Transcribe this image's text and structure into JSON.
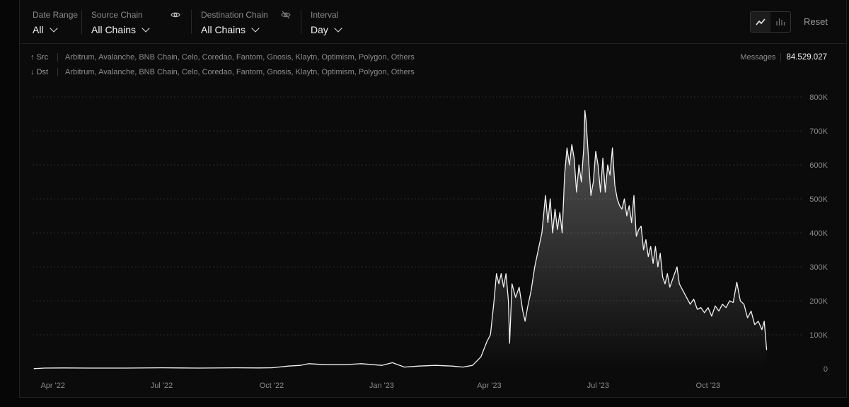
{
  "filters": {
    "date_range": {
      "label": "Date Range",
      "value": "All"
    },
    "source_chain": {
      "label": "Source Chain",
      "value": "All Chains"
    },
    "destination_chain": {
      "label": "Destination Chain",
      "value": "All Chains"
    },
    "interval": {
      "label": "Interval",
      "value": "Day"
    }
  },
  "view_toggle": {
    "selected": "line",
    "options": [
      "line-chart-icon",
      "bar-chart-icon"
    ]
  },
  "reset_label": "Reset",
  "legend": {
    "src": {
      "key": "Src",
      "chains": "Arbitrum, Avalanche, BNB Chain, Celo, Coredao, Fantom, Gnosis, Klaytn, Optimism, Polygon, Others"
    },
    "dst": {
      "key": "Dst",
      "chains": "Arbitrum, Avalanche, BNB Chain, Celo, Coredao, Fantom, Gnosis, Klaytn, Optimism, Polygon, Others"
    }
  },
  "messages": {
    "label": "Messages",
    "value": "84.529.027"
  },
  "colors": {
    "background": "#0b0b0b",
    "line": "#f2f2f2",
    "grid": "#2a2a2a",
    "text_muted": "#8a8a8a"
  },
  "chart_data": {
    "type": "area",
    "x_range": [
      "2022-03-15",
      "2023-12-20"
    ],
    "ylim": [
      0,
      800000
    ],
    "yticks": [
      0,
      100000,
      200000,
      300000,
      400000,
      500000,
      600000,
      700000,
      800000
    ],
    "ytick_labels": [
      "0",
      "100K",
      "200K",
      "300K",
      "400K",
      "500K",
      "600K",
      "700K",
      "800K"
    ],
    "xticks": [
      "2022-04-01",
      "2022-07-01",
      "2022-10-01",
      "2023-01-01",
      "2023-04-01",
      "2023-07-01",
      "2023-10-01"
    ],
    "xtick_labels": [
      "Apr '22",
      "Jul '22",
      "Oct '22",
      "Jan '23",
      "Apr '23",
      "Jul '23",
      "Oct '23"
    ],
    "grid": true,
    "series": [
      {
        "values": [
          [
            "2022-03-16",
            500
          ],
          [
            "2022-03-25",
            2000
          ],
          [
            "2022-04-10",
            2500
          ],
          [
            "2022-05-01",
            2000
          ],
          [
            "2022-06-01",
            2000
          ],
          [
            "2022-07-01",
            3000
          ],
          [
            "2022-08-01",
            2000
          ],
          [
            "2022-09-01",
            3000
          ],
          [
            "2022-09-20",
            2500
          ],
          [
            "2022-10-01",
            3000
          ],
          [
            "2022-10-15",
            8000
          ],
          [
            "2022-10-25",
            10000
          ],
          [
            "2022-11-01",
            15000
          ],
          [
            "2022-11-15",
            12000
          ],
          [
            "2022-12-01",
            12000
          ],
          [
            "2022-12-15",
            15000
          ],
          [
            "2023-01-01",
            10000
          ],
          [
            "2023-01-10",
            18000
          ],
          [
            "2023-01-20",
            5000
          ],
          [
            "2023-02-01",
            8000
          ],
          [
            "2023-02-15",
            10000
          ],
          [
            "2023-03-01",
            8000
          ],
          [
            "2023-03-10",
            5000
          ],
          [
            "2023-03-18",
            10000
          ],
          [
            "2023-03-25",
            35000
          ],
          [
            "2023-03-30",
            80000
          ],
          [
            "2023-04-02",
            100000
          ],
          [
            "2023-04-05",
            200000
          ],
          [
            "2023-04-07",
            280000
          ],
          [
            "2023-04-09",
            250000
          ],
          [
            "2023-04-11",
            280000
          ],
          [
            "2023-04-13",
            240000
          ],
          [
            "2023-04-15",
            280000
          ],
          [
            "2023-04-17",
            200000
          ],
          [
            "2023-04-18",
            75000
          ],
          [
            "2023-04-20",
            250000
          ],
          [
            "2023-04-23",
            210000
          ],
          [
            "2023-04-26",
            240000
          ],
          [
            "2023-04-29",
            170000
          ],
          [
            "2023-05-01",
            140000
          ],
          [
            "2023-05-03",
            180000
          ],
          [
            "2023-05-06",
            230000
          ],
          [
            "2023-05-09",
            300000
          ],
          [
            "2023-05-12",
            350000
          ],
          [
            "2023-05-15",
            400000
          ],
          [
            "2023-05-18",
            510000
          ],
          [
            "2023-05-20",
            430000
          ],
          [
            "2023-05-22",
            500000
          ],
          [
            "2023-05-24",
            400000
          ],
          [
            "2023-05-26",
            470000
          ],
          [
            "2023-05-28",
            410000
          ],
          [
            "2023-05-30",
            460000
          ],
          [
            "2023-06-01",
            400000
          ],
          [
            "2023-06-03",
            570000
          ],
          [
            "2023-06-05",
            650000
          ],
          [
            "2023-06-07",
            600000
          ],
          [
            "2023-06-09",
            660000
          ],
          [
            "2023-06-11",
            620000
          ],
          [
            "2023-06-13",
            520000
          ],
          [
            "2023-06-15",
            600000
          ],
          [
            "2023-06-17",
            550000
          ],
          [
            "2023-06-19",
            650000
          ],
          [
            "2023-06-20",
            760000
          ],
          [
            "2023-06-21",
            730000
          ],
          [
            "2023-06-23",
            620000
          ],
          [
            "2023-06-25",
            510000
          ],
          [
            "2023-06-27",
            550000
          ],
          [
            "2023-06-29",
            640000
          ],
          [
            "2023-07-01",
            600000
          ],
          [
            "2023-07-03",
            520000
          ],
          [
            "2023-07-05",
            620000
          ],
          [
            "2023-07-07",
            520000
          ],
          [
            "2023-07-09",
            600000
          ],
          [
            "2023-07-11",
            570000
          ],
          [
            "2023-07-13",
            650000
          ],
          [
            "2023-07-15",
            540000
          ],
          [
            "2023-07-17",
            500000
          ],
          [
            "2023-07-19",
            480000
          ],
          [
            "2023-07-21",
            470000
          ],
          [
            "2023-07-23",
            500000
          ],
          [
            "2023-07-25",
            450000
          ],
          [
            "2023-07-27",
            480000
          ],
          [
            "2023-07-29",
            430000
          ],
          [
            "2023-07-31",
            510000
          ],
          [
            "2023-08-02",
            390000
          ],
          [
            "2023-08-04",
            410000
          ],
          [
            "2023-08-06",
            420000
          ],
          [
            "2023-08-08",
            350000
          ],
          [
            "2023-08-10",
            380000
          ],
          [
            "2023-08-12",
            330000
          ],
          [
            "2023-08-14",
            360000
          ],
          [
            "2023-08-16",
            310000
          ],
          [
            "2023-08-18",
            360000
          ],
          [
            "2023-08-20",
            300000
          ],
          [
            "2023-08-22",
            340000
          ],
          [
            "2023-08-24",
            270000
          ],
          [
            "2023-08-26",
            250000
          ],
          [
            "2023-08-28",
            280000
          ],
          [
            "2023-08-30",
            240000
          ],
          [
            "2023-09-02",
            270000
          ],
          [
            "2023-09-05",
            300000
          ],
          [
            "2023-09-07",
            250000
          ],
          [
            "2023-09-10",
            230000
          ],
          [
            "2023-09-13",
            210000
          ],
          [
            "2023-09-16",
            190000
          ],
          [
            "2023-09-19",
            205000
          ],
          [
            "2023-09-22",
            175000
          ],
          [
            "2023-09-25",
            180000
          ],
          [
            "2023-09-28",
            165000
          ],
          [
            "2023-10-01",
            180000
          ],
          [
            "2023-10-04",
            155000
          ],
          [
            "2023-10-07",
            185000
          ],
          [
            "2023-10-10",
            170000
          ],
          [
            "2023-10-13",
            190000
          ],
          [
            "2023-10-16",
            180000
          ],
          [
            "2023-10-19",
            200000
          ],
          [
            "2023-10-22",
            195000
          ],
          [
            "2023-10-25",
            255000
          ],
          [
            "2023-10-28",
            200000
          ],
          [
            "2023-10-31",
            190000
          ],
          [
            "2023-11-03",
            150000
          ],
          [
            "2023-11-06",
            170000
          ],
          [
            "2023-11-09",
            130000
          ],
          [
            "2023-11-12",
            140000
          ],
          [
            "2023-11-15",
            115000
          ],
          [
            "2023-11-17",
            140000
          ],
          [
            "2023-11-19",
            55000
          ]
        ]
      }
    ]
  }
}
